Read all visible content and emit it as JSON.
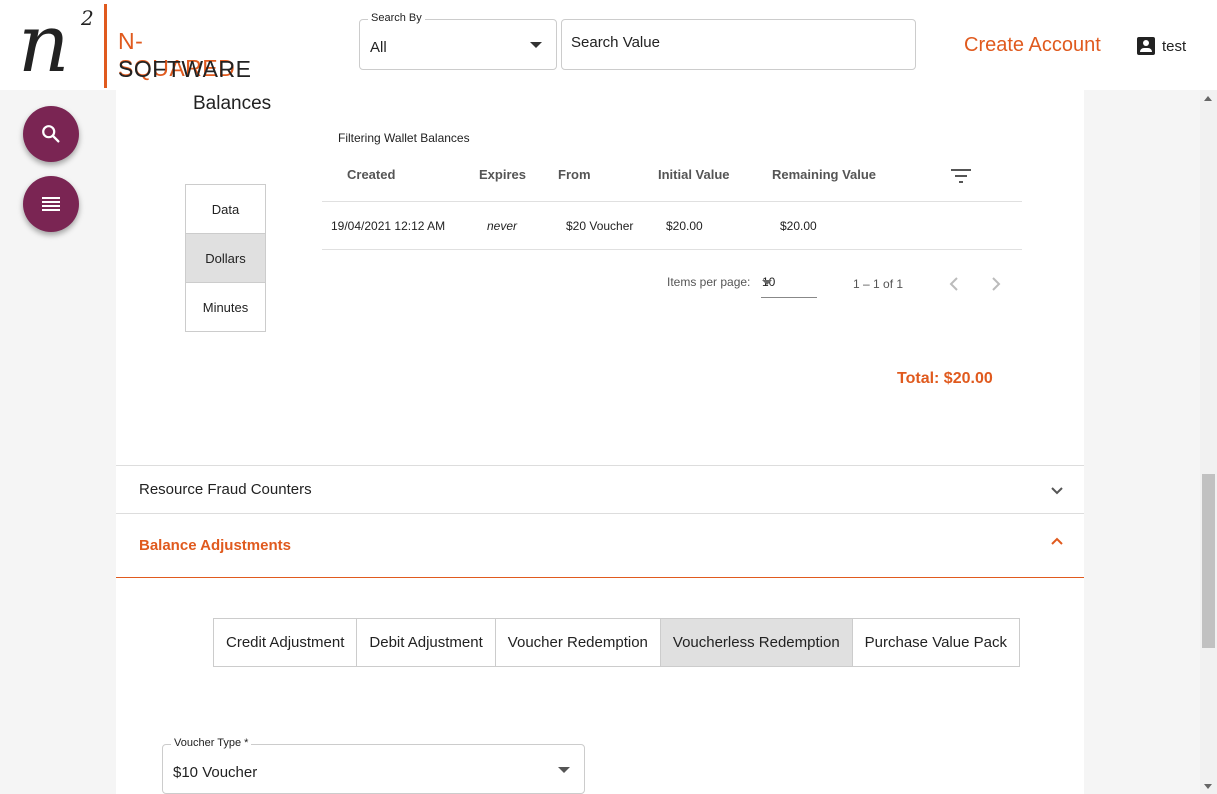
{
  "brand": {
    "logo_symbol": "n",
    "logo_superscript": "2",
    "name_line1": "N-SQUARED",
    "name_line2": "SOFTWARE",
    "accent_color": "#e05a1e"
  },
  "header": {
    "search_by_label": "Search By",
    "search_by_value": "All",
    "search_value_placeholder": "Search Value",
    "create_account": "Create Account",
    "user_name": "test"
  },
  "fabs": {
    "search_icon": "search-icon",
    "menu_icon": "list-icon",
    "color": "#7a2553"
  },
  "balances": {
    "title": "Balances",
    "types": [
      "Data",
      "Dollars",
      "Minutes"
    ],
    "selected_type": "Dollars",
    "filter_caption": "Filtering Wallet Balances",
    "columns": [
      "Created",
      "Expires",
      "From",
      "Initial Value",
      "Remaining Value"
    ],
    "rows": [
      {
        "created": "19/04/2021 12:12 AM",
        "expires": "never",
        "from": "$20 Voucher",
        "initial": "$20.00",
        "remaining": "$20.00"
      }
    ],
    "pager": {
      "items_per_page_label": "Items per page:",
      "items_per_page": "10",
      "range": "1 – 1 of 1"
    },
    "total": "Total: $20.00"
  },
  "panels": {
    "fraud_title": "Resource Fraud Counters",
    "adjustments_title": "Balance Adjustments"
  },
  "adjustments": {
    "tabs": [
      "Credit Adjustment",
      "Debit Adjustment",
      "Voucher Redemption",
      "Voucherless Redemption",
      "Purchase Value Pack"
    ],
    "selected_tab": "Voucherless Redemption",
    "voucher_type_label": "Voucher Type *",
    "voucher_type_value": "$10 Voucher"
  }
}
